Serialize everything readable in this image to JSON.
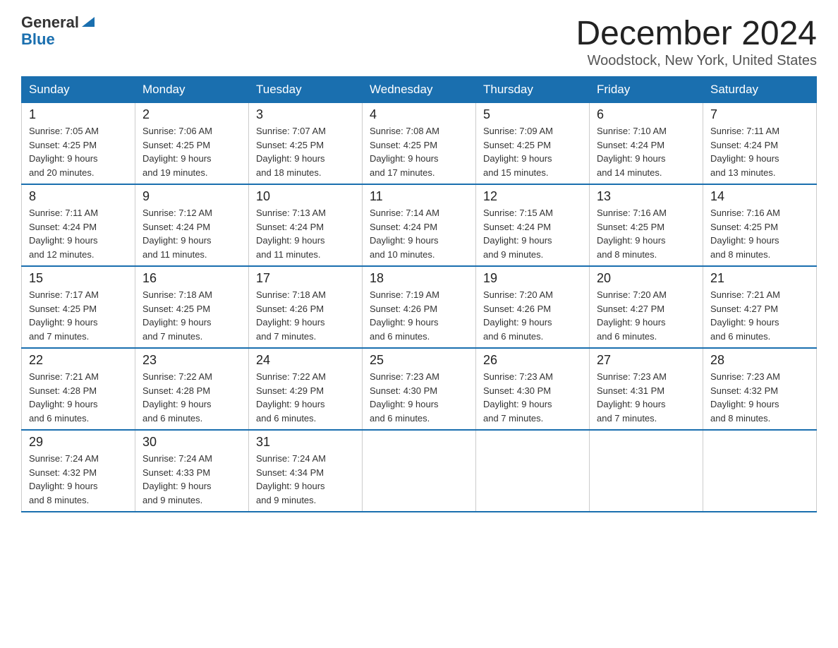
{
  "header": {
    "logo_general": "General",
    "logo_blue": "Blue",
    "month_title": "December 2024",
    "location": "Woodstock, New York, United States"
  },
  "days_of_week": [
    "Sunday",
    "Monday",
    "Tuesday",
    "Wednesday",
    "Thursday",
    "Friday",
    "Saturday"
  ],
  "weeks": [
    [
      {
        "day": "1",
        "sunrise": "7:05 AM",
        "sunset": "4:25 PM",
        "daylight": "9 hours and 20 minutes."
      },
      {
        "day": "2",
        "sunrise": "7:06 AM",
        "sunset": "4:25 PM",
        "daylight": "9 hours and 19 minutes."
      },
      {
        "day": "3",
        "sunrise": "7:07 AM",
        "sunset": "4:25 PM",
        "daylight": "9 hours and 18 minutes."
      },
      {
        "day": "4",
        "sunrise": "7:08 AM",
        "sunset": "4:25 PM",
        "daylight": "9 hours and 17 minutes."
      },
      {
        "day": "5",
        "sunrise": "7:09 AM",
        "sunset": "4:25 PM",
        "daylight": "9 hours and 15 minutes."
      },
      {
        "day": "6",
        "sunrise": "7:10 AM",
        "sunset": "4:24 PM",
        "daylight": "9 hours and 14 minutes."
      },
      {
        "day": "7",
        "sunrise": "7:11 AM",
        "sunset": "4:24 PM",
        "daylight": "9 hours and 13 minutes."
      }
    ],
    [
      {
        "day": "8",
        "sunrise": "7:11 AM",
        "sunset": "4:24 PM",
        "daylight": "9 hours and 12 minutes."
      },
      {
        "day": "9",
        "sunrise": "7:12 AM",
        "sunset": "4:24 PM",
        "daylight": "9 hours and 11 minutes."
      },
      {
        "day": "10",
        "sunrise": "7:13 AM",
        "sunset": "4:24 PM",
        "daylight": "9 hours and 11 minutes."
      },
      {
        "day": "11",
        "sunrise": "7:14 AM",
        "sunset": "4:24 PM",
        "daylight": "9 hours and 10 minutes."
      },
      {
        "day": "12",
        "sunrise": "7:15 AM",
        "sunset": "4:24 PM",
        "daylight": "9 hours and 9 minutes."
      },
      {
        "day": "13",
        "sunrise": "7:16 AM",
        "sunset": "4:25 PM",
        "daylight": "9 hours and 8 minutes."
      },
      {
        "day": "14",
        "sunrise": "7:16 AM",
        "sunset": "4:25 PM",
        "daylight": "9 hours and 8 minutes."
      }
    ],
    [
      {
        "day": "15",
        "sunrise": "7:17 AM",
        "sunset": "4:25 PM",
        "daylight": "9 hours and 7 minutes."
      },
      {
        "day": "16",
        "sunrise": "7:18 AM",
        "sunset": "4:25 PM",
        "daylight": "9 hours and 7 minutes."
      },
      {
        "day": "17",
        "sunrise": "7:18 AM",
        "sunset": "4:26 PM",
        "daylight": "9 hours and 7 minutes."
      },
      {
        "day": "18",
        "sunrise": "7:19 AM",
        "sunset": "4:26 PM",
        "daylight": "9 hours and 6 minutes."
      },
      {
        "day": "19",
        "sunrise": "7:20 AM",
        "sunset": "4:26 PM",
        "daylight": "9 hours and 6 minutes."
      },
      {
        "day": "20",
        "sunrise": "7:20 AM",
        "sunset": "4:27 PM",
        "daylight": "9 hours and 6 minutes."
      },
      {
        "day": "21",
        "sunrise": "7:21 AM",
        "sunset": "4:27 PM",
        "daylight": "9 hours and 6 minutes."
      }
    ],
    [
      {
        "day": "22",
        "sunrise": "7:21 AM",
        "sunset": "4:28 PM",
        "daylight": "9 hours and 6 minutes."
      },
      {
        "day": "23",
        "sunrise": "7:22 AM",
        "sunset": "4:28 PM",
        "daylight": "9 hours and 6 minutes."
      },
      {
        "day": "24",
        "sunrise": "7:22 AM",
        "sunset": "4:29 PM",
        "daylight": "9 hours and 6 minutes."
      },
      {
        "day": "25",
        "sunrise": "7:23 AM",
        "sunset": "4:30 PM",
        "daylight": "9 hours and 6 minutes."
      },
      {
        "day": "26",
        "sunrise": "7:23 AM",
        "sunset": "4:30 PM",
        "daylight": "9 hours and 7 minutes."
      },
      {
        "day": "27",
        "sunrise": "7:23 AM",
        "sunset": "4:31 PM",
        "daylight": "9 hours and 7 minutes."
      },
      {
        "day": "28",
        "sunrise": "7:23 AM",
        "sunset": "4:32 PM",
        "daylight": "9 hours and 8 minutes."
      }
    ],
    [
      {
        "day": "29",
        "sunrise": "7:24 AM",
        "sunset": "4:32 PM",
        "daylight": "9 hours and 8 minutes."
      },
      {
        "day": "30",
        "sunrise": "7:24 AM",
        "sunset": "4:33 PM",
        "daylight": "9 hours and 9 minutes."
      },
      {
        "day": "31",
        "sunrise": "7:24 AM",
        "sunset": "4:34 PM",
        "daylight": "9 hours and 9 minutes."
      },
      null,
      null,
      null,
      null
    ]
  ],
  "labels": {
    "sunrise": "Sunrise:",
    "sunset": "Sunset:",
    "daylight": "Daylight:"
  }
}
